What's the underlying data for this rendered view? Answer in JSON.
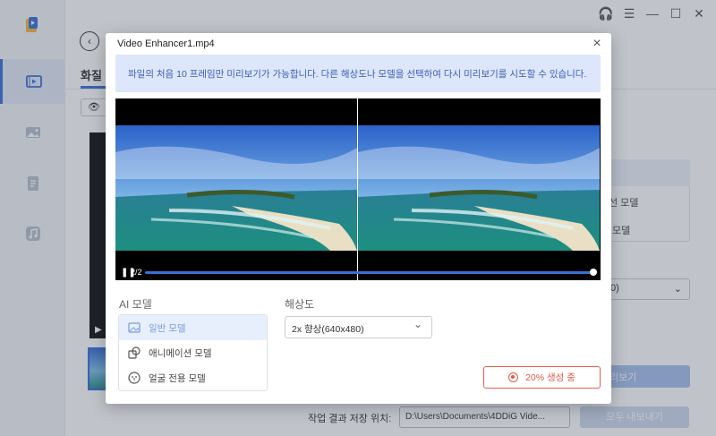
{
  "background": {
    "tab_label": "화질 개",
    "right_model_1": "선 모델",
    "right_model_2": "모델",
    "right_select_value": "0)",
    "preview_button": "리보기",
    "save_location_label": "작업 결과 저장 위치:",
    "save_location_value": "D:\\Users\\Documents\\4DDiG Vide...",
    "export_all_button": "모두 내보내기",
    "video_play_glyph": "▶"
  },
  "dialog": {
    "title": "Video Enhancer1.mp4",
    "notice": "파일의 처음 10 프레임만 미리보기가 가능합니다. 다른 해상도나 모델을 선택하여 다시 미리보기를 시도할 수 있습니다.",
    "player": {
      "frame_counter": "2/2",
      "progress": 1.0
    },
    "ai_model_label": "AI 모델",
    "models": [
      {
        "label": "일반 모델",
        "icon": "image-icon",
        "selected": true
      },
      {
        "label": "애니메이션 모델",
        "icon": "shapes-icon",
        "selected": false
      },
      {
        "label": "얼굴 전용 모델",
        "icon": "face-icon",
        "selected": false
      }
    ],
    "resolution_label": "해상도",
    "resolution_value": "2x 향상(640x480)",
    "generate_button": "20% 생성 중"
  },
  "colors": {
    "accent": "#3a6fd8",
    "notice_bg": "#dde6fb",
    "notice_text": "#3a5fb3",
    "generate": "#e05a44"
  }
}
